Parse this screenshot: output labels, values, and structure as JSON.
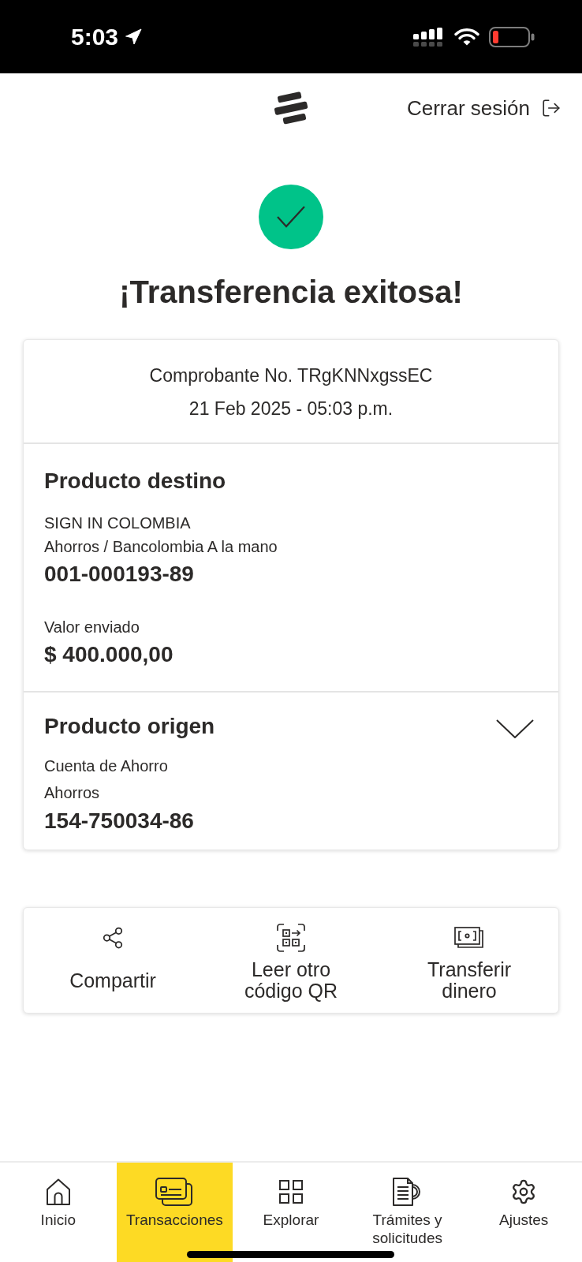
{
  "status_bar": {
    "time": "5:03"
  },
  "header": {
    "logout_label": "Cerrar sesión"
  },
  "result": {
    "title": "¡Transferencia exitosa!"
  },
  "receipt": {
    "number": "Comprobante No. TRgKNNxgssEC",
    "date": "21 Feb 2025 - 05:03 p.m."
  },
  "destination": {
    "heading": "Producto destino",
    "name": "SIGN IN COLOMBIA",
    "product": "Ahorros / Bancolombia A la mano",
    "account": "001-000193-89",
    "amount_label": "Valor enviado",
    "amount": "$ 400.000,00"
  },
  "origin": {
    "heading": "Producto origen",
    "expanded": false,
    "name": "Cuenta de Ahorro",
    "product": "Ahorros",
    "account": "154-750034-86"
  },
  "actions": [
    {
      "kind": "share",
      "label": "Compartir"
    },
    {
      "kind": "qr",
      "label": "Leer otro código QR"
    },
    {
      "kind": "money",
      "label": "Transferir dinero"
    }
  ],
  "nav": [
    {
      "kind": "home",
      "label": "Inicio",
      "selected": false
    },
    {
      "kind": "cards",
      "label": "Transacciones",
      "selected": true
    },
    {
      "kind": "grid",
      "label": "Explorar",
      "selected": false
    },
    {
      "kind": "documents",
      "label": "Trámites y solicitudes",
      "selected": false
    },
    {
      "kind": "settings",
      "label": "Ajustes",
      "selected": false
    }
  ]
}
